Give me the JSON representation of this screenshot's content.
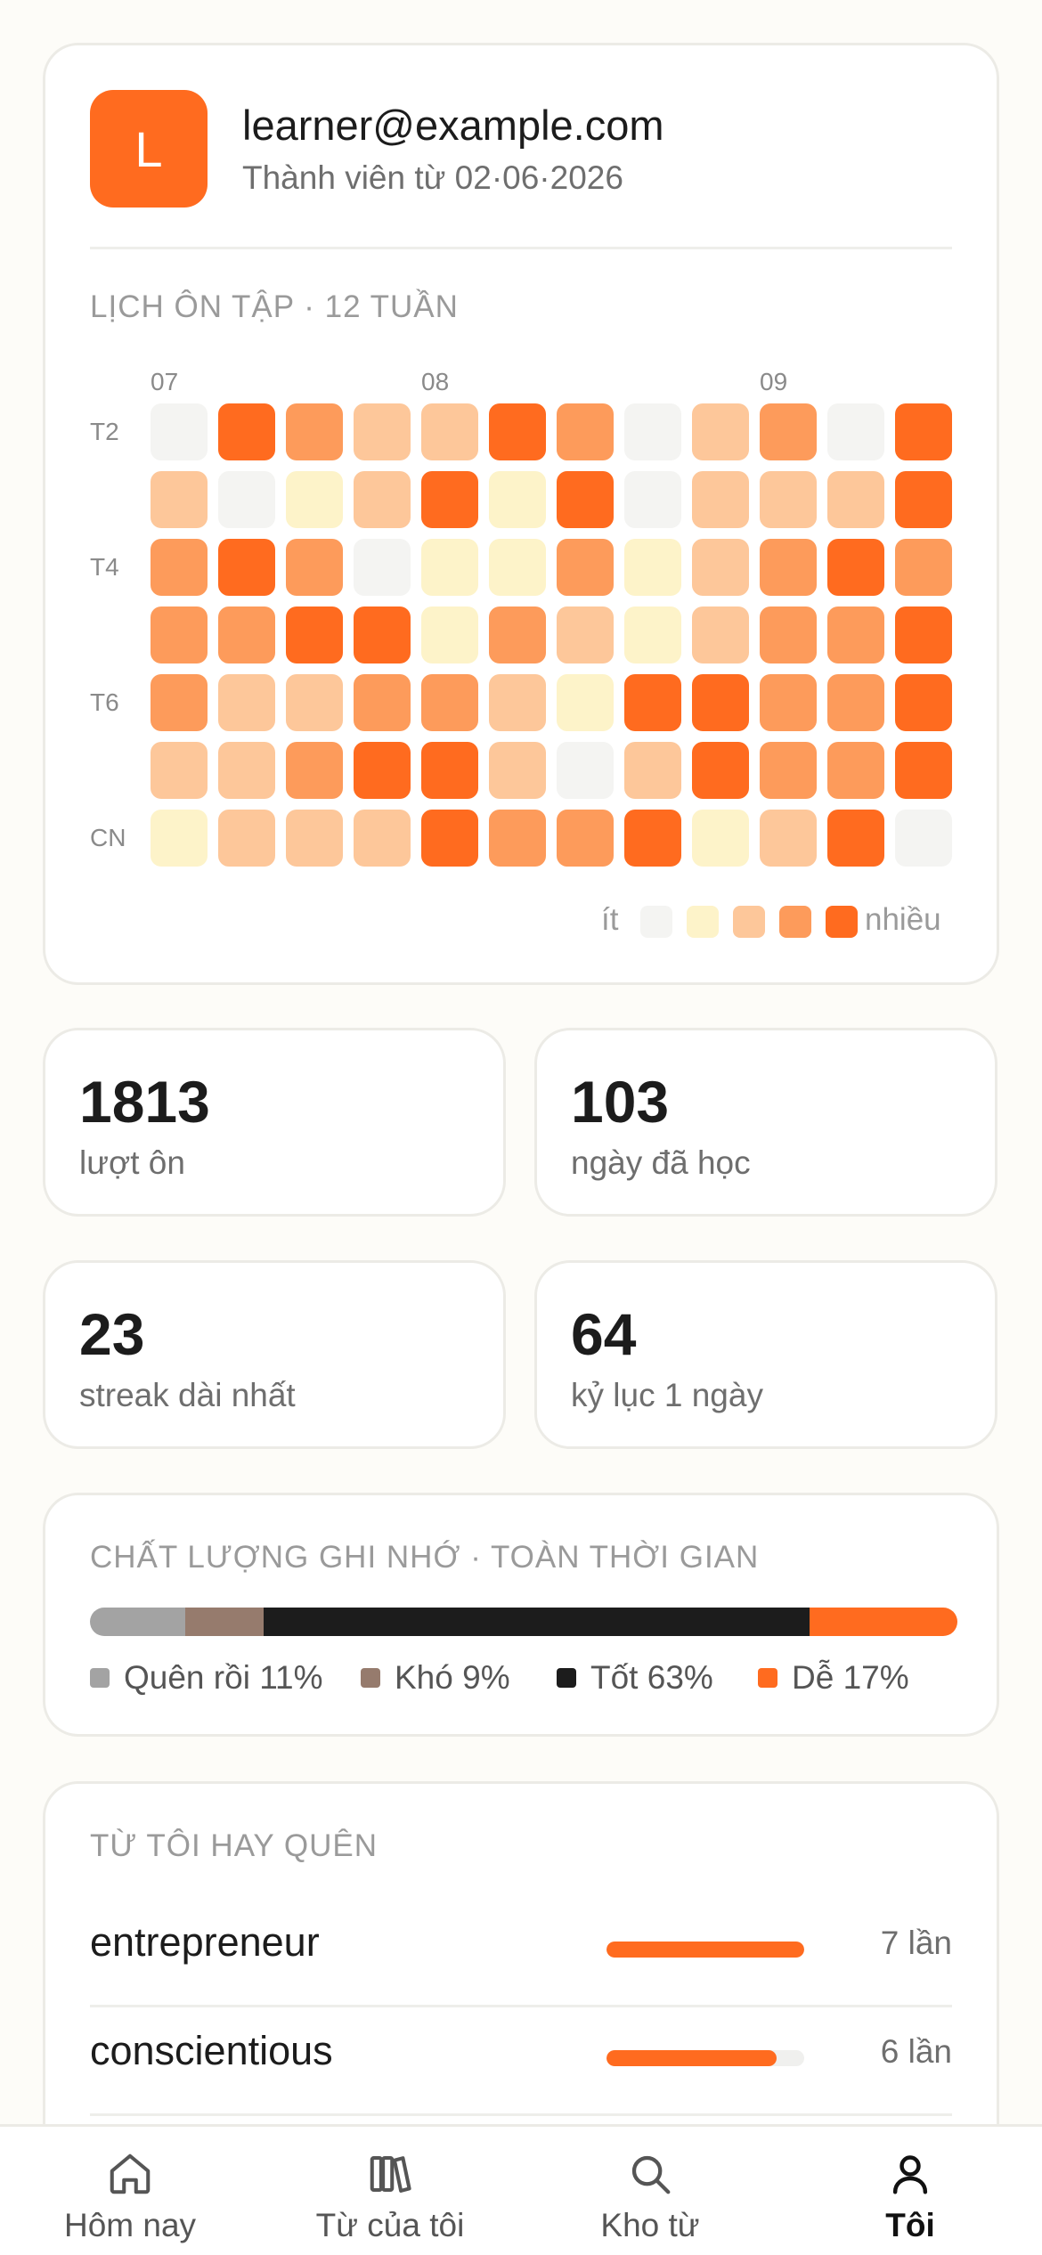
{
  "profile": {
    "avatar_letter": "L",
    "email": "learner@example.com",
    "member_since": "Thành viên từ 02·06·2026"
  },
  "calendar": {
    "title": "LỊCH ÔN TẬP · 12 TUẦN",
    "months": [
      {
        "label": "07",
        "week": 0
      },
      {
        "label": "08",
        "week": 4
      },
      {
        "label": "09",
        "week": 9
      }
    ],
    "day_labels": [
      {
        "label": "T2",
        "row": 0
      },
      {
        "label": "T4",
        "row": 2
      },
      {
        "label": "T6",
        "row": 4
      },
      {
        "label": "CN",
        "row": 6
      }
    ],
    "levels": [
      [
        0,
        4,
        3,
        2,
        2,
        4,
        3,
        0,
        2,
        3,
        0,
        4
      ],
      [
        2,
        0,
        1,
        2,
        4,
        1,
        4,
        0,
        2,
        2,
        2,
        4
      ],
      [
        3,
        4,
        3,
        0,
        1,
        1,
        3,
        1,
        2,
        3,
        4,
        3
      ],
      [
        3,
        3,
        4,
        4,
        1,
        3,
        2,
        1,
        2,
        3,
        3,
        4
      ],
      [
        3,
        2,
        2,
        3,
        3,
        2,
        1,
        4,
        4,
        3,
        3,
        4
      ],
      [
        2,
        2,
        3,
        4,
        4,
        2,
        0,
        2,
        4,
        3,
        3,
        4
      ],
      [
        1,
        2,
        2,
        2,
        4,
        3,
        3,
        4,
        1,
        2,
        4,
        0
      ]
    ],
    "level_colors": [
      "#f4f4f2",
      "#fdf3c9",
      "#fdc79a",
      "#fd9b5b",
      "#ff6b1f"
    ],
    "legend_low": "ít",
    "legend_high": "nhiều"
  },
  "stats": [
    {
      "value": "1813",
      "label": "lượt ôn"
    },
    {
      "value": "103",
      "label": "ngày đã học"
    },
    {
      "value": "23",
      "label": "streak dài nhất"
    },
    {
      "value": "64",
      "label": "kỷ lục 1 ngày"
    }
  ],
  "quality": {
    "title": "CHẤT LƯỢNG GHI NHỚ · TOÀN THỜI GIAN",
    "segments": [
      {
        "label": "Quên rồi 11%",
        "percent": 11,
        "color": "#a3a3a3"
      },
      {
        "label": "Khó 9%",
        "percent": 9,
        "color": "#967b6d"
      },
      {
        "label": "Tốt 63%",
        "percent": 63,
        "color": "#1c1c1c"
      },
      {
        "label": "Dễ 17%",
        "percent": 17,
        "color": "#ff6b1f"
      }
    ]
  },
  "forgotten": {
    "title": "TỪ TÔI HAY QUÊN",
    "items": [
      {
        "word": "entrepreneur",
        "count": "7 lần",
        "fraction": 1.0
      },
      {
        "word": "conscientious",
        "count": "6 lần",
        "fraction": 0.86
      }
    ]
  },
  "tabs": [
    {
      "label": "Hôm nay",
      "icon": "home-icon",
      "active": false
    },
    {
      "label": "Từ của tôi",
      "icon": "books-icon",
      "active": false
    },
    {
      "label": "Kho từ",
      "icon": "search-icon",
      "active": false
    },
    {
      "label": "Tôi",
      "icon": "user-icon",
      "active": true
    }
  ]
}
